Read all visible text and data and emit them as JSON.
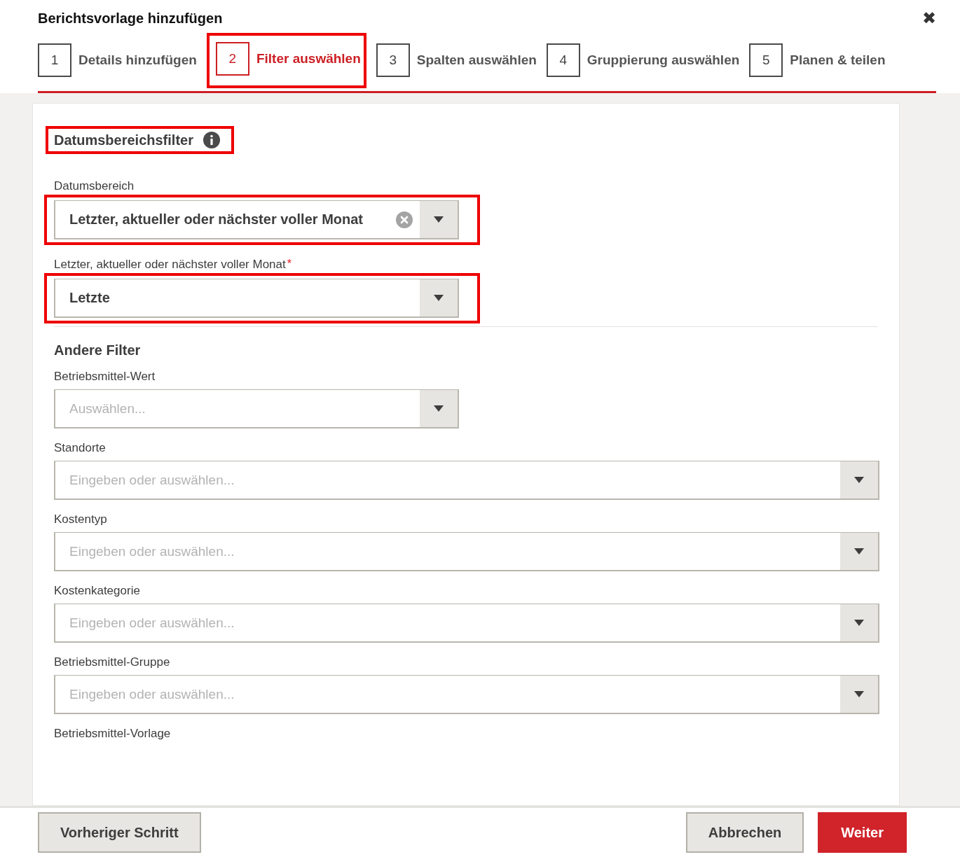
{
  "dialog": {
    "title": "Berichtsvorlage hinzufügen",
    "close_icon": "✖"
  },
  "steps": [
    {
      "number": "1",
      "label": "Details hinzufügen",
      "selected": false
    },
    {
      "number": "2",
      "label": "Filter auswählen",
      "selected": true,
      "highlighted": true
    },
    {
      "number": "3",
      "label": "Spalten auswählen",
      "selected": false
    },
    {
      "number": "4",
      "label": "Gruppierung auswählen",
      "selected": false
    },
    {
      "number": "5",
      "label": "Planen & teilen",
      "selected": false
    }
  ],
  "date_filter": {
    "heading": "Datumsbereichsfilter",
    "highlighted": true,
    "fields": [
      {
        "label": "Datumsbereich",
        "kind": "select",
        "value": "Letzter, aktueller oder nächster voller Monat",
        "clearable": true,
        "highlighted": true
      },
      {
        "label": "Letzter, aktueller oder nächster voller Monat",
        "required_mark": "*",
        "kind": "select",
        "value": "Letzte",
        "highlighted": true
      }
    ]
  },
  "other_filters": {
    "heading": "Andere Filter",
    "fields": [
      {
        "label": "Betriebsmittel-Wert",
        "kind": "select",
        "placeholder": "Auswählen..."
      },
      {
        "label": "Standorte",
        "kind": "combobox",
        "placeholder": "Eingeben oder auswählen..."
      },
      {
        "label": "Kostentyp",
        "kind": "combobox",
        "placeholder": "Eingeben oder auswählen..."
      },
      {
        "label": "Kostenkategorie",
        "kind": "combobox",
        "placeholder": "Eingeben oder auswählen..."
      },
      {
        "label": "Betriebsmittel-Gruppe",
        "kind": "combobox",
        "placeholder": "Eingeben oder auswählen..."
      },
      {
        "label": "Betriebsmittel-Vorlage"
      }
    ]
  },
  "footer": {
    "back": "Vorheriger Schritt",
    "cancel": "Abbrechen",
    "next": "Weiter"
  }
}
